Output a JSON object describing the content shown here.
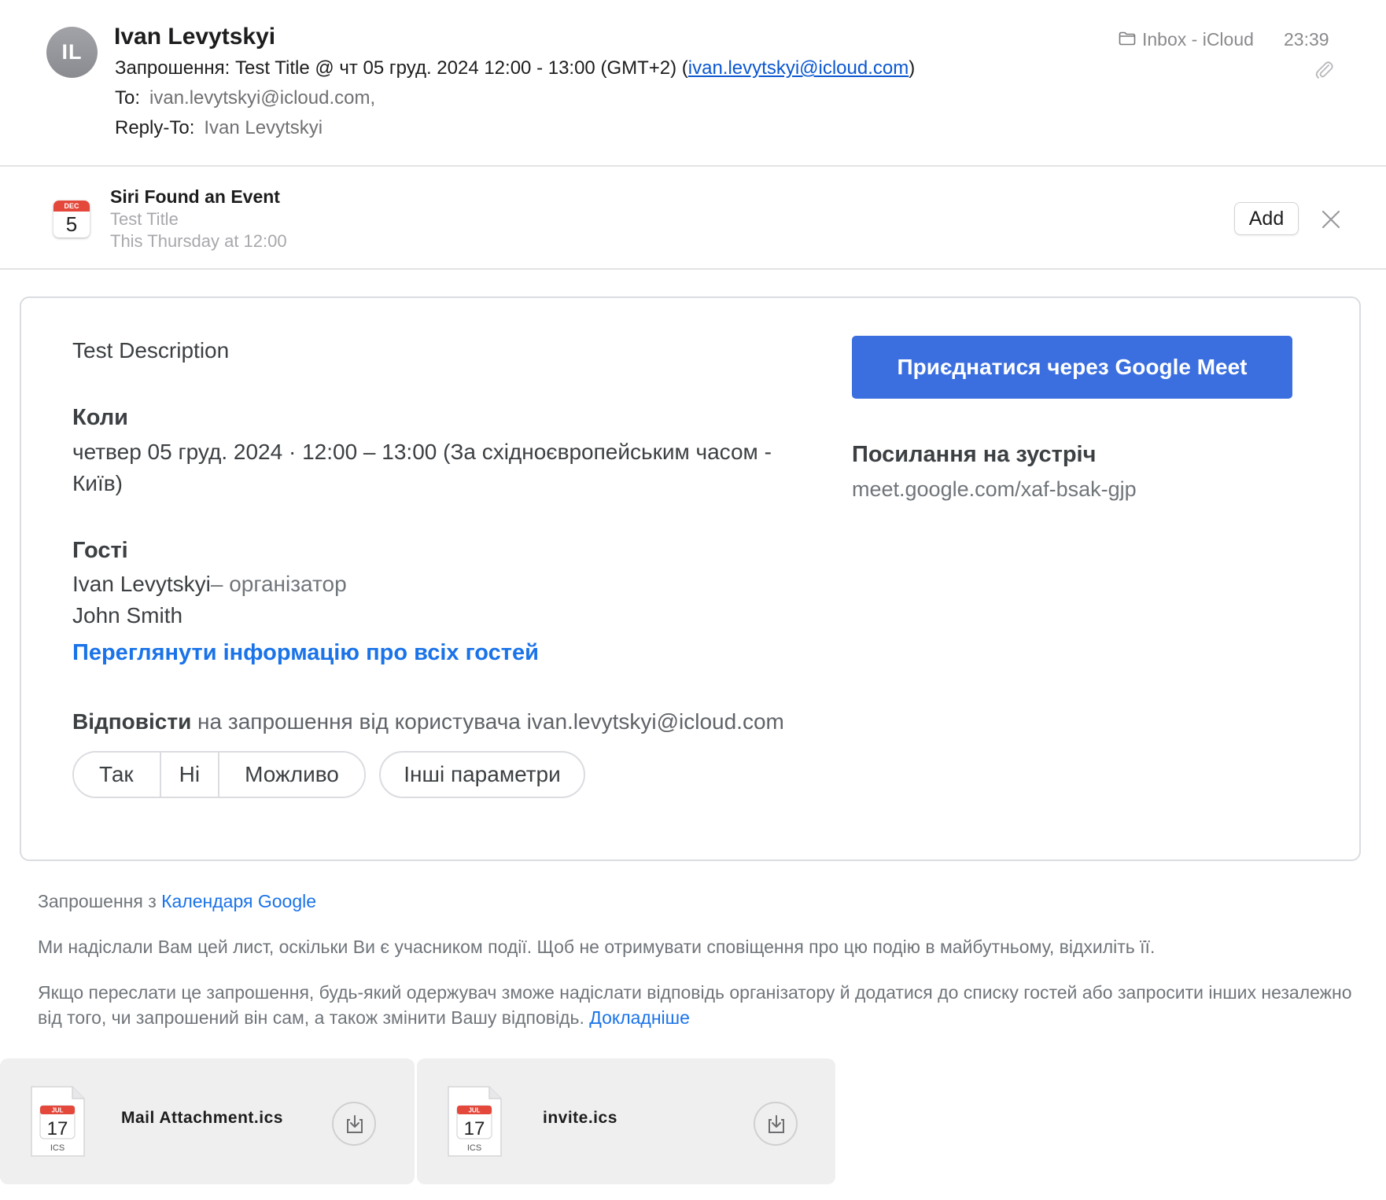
{
  "header": {
    "avatar_initials": "IL",
    "sender": "Ivan Levytskyi",
    "subject_prefix": "Запрошення: Test Title @ чт 05 груд. 2024 12:00 - 13:00 (GMT+2) (",
    "subject_email": "ivan.levytskyi@icloud.com",
    "subject_suffix": ")",
    "to_label": "To:",
    "to_value": "ivan.levytskyi@icloud.com,",
    "reply_to_label": "Reply-To:",
    "reply_to_value": "Ivan Levytskyi",
    "mailbox": "Inbox - iCloud",
    "time": "23:39",
    "icons": [
      "folder-icon",
      "paperclip-icon"
    ]
  },
  "siri": {
    "icon_month": "DEC",
    "icon_day": "5",
    "title": "Siri Found an Event",
    "event_title": "Test Title",
    "event_when": "This Thursday at 12:00",
    "add_label": "Add",
    "close_icon": "close-icon"
  },
  "invite": {
    "description": "Test Description",
    "when_heading": "Коли",
    "when_value": "четвер 05 груд. 2024 · 12:00 – 13:00 (За східноєвропейським часом - Київ)",
    "guests_heading": "Гості",
    "guests": [
      {
        "name": "Ivan Levytskyi",
        "role": "– організатор"
      },
      {
        "name": "John Smith",
        "role": ""
      }
    ],
    "view_all_guests": "Переглянути інформацію про всіх гостей",
    "reply_bold": "Відповісти",
    "reply_rest": " на запрошення від користувача ivan.levytskyi@icloud.com",
    "rsvp_yes": "Так",
    "rsvp_no": "Ні",
    "rsvp_maybe": "Можливо",
    "more_options": "Інші параметри",
    "meet_button": "Приєднатися через Google Meet",
    "meet_heading": "Посилання на зустріч",
    "meet_link": "meet.google.com/xaf-bsak-gjp",
    "accent_color": "#3b6fe0",
    "link_color": "#1a73e8"
  },
  "footer": {
    "invitation_from": "Запрошення з ",
    "calendar_link": "Календаря Google",
    "notice": "Ми надіслали Вам цей лист, оскільки Ви є учасником події. Щоб не отримувати сповіщення про цю подію в майбутньому, відхиліть її.",
    "forward_notice": "Якщо переслати це запрошення, будь-який одержувач зможе надіслати відповідь організатору й додатися до списку гостей або запросити інших незалежно від того, чи запрошений він сам, а також змінити Вашу відповідь. ",
    "learn_more": "Докладніше"
  },
  "attachments": [
    {
      "name": "Mail Attachment.ics",
      "icon_month": "JUL",
      "icon_day": "17",
      "icon_ext": "ICS"
    },
    {
      "name": "invite.ics",
      "icon_month": "JUL",
      "icon_day": "17",
      "icon_ext": "ICS"
    }
  ]
}
